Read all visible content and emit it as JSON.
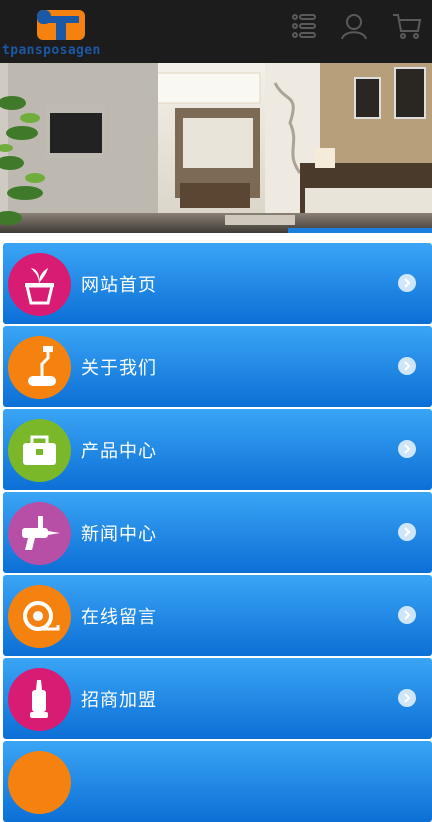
{
  "header": {
    "logo_text": "tpansposagen",
    "icons": [
      "list-icon",
      "user-icon",
      "cart-icon"
    ]
  },
  "menu": {
    "items": [
      {
        "label": "网站首页",
        "icon": "plant-pot-icon",
        "color": "#d81b73"
      },
      {
        "label": "关于我们",
        "icon": "paint-roller-icon",
        "color": "#f5820f"
      },
      {
        "label": "产品中心",
        "icon": "toolbox-icon",
        "color": "#7ab82a"
      },
      {
        "label": "新闻中心",
        "icon": "glue-gun-icon",
        "color": "#b84fa6"
      },
      {
        "label": "在线留言",
        "icon": "tape-measure-icon",
        "color": "#f5820f"
      },
      {
        "label": "招商加盟",
        "icon": "caulk-tube-icon",
        "color": "#d81b73"
      },
      {
        "label": "",
        "icon": "circle-icon",
        "color": "#f5820f"
      }
    ]
  },
  "colors": {
    "header_bg": "#1c1c1c",
    "brand_blue": "#1b58a6",
    "logo_orange": "#f5820f",
    "menu_top": "#3aa5f5",
    "menu_bottom": "#0c6fd6"
  }
}
